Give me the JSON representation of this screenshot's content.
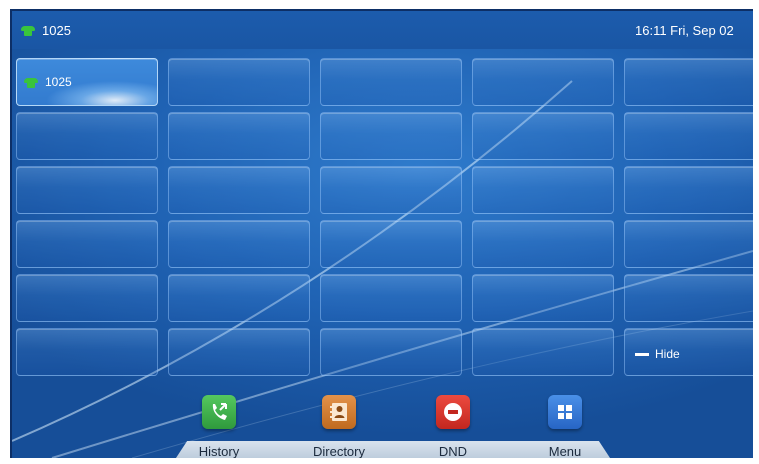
{
  "status_bar": {
    "account": "1025",
    "datetime": "16:11 Fri, Sep 02"
  },
  "line_keys": {
    "selected_label": "1025",
    "hide_label": "Hide"
  },
  "softkeys": [
    {
      "label": "History",
      "icon": "phone-history-icon",
      "color": "#3aa84a"
    },
    {
      "label": "Directory",
      "icon": "contact-card-icon",
      "color": "#d27a2a"
    },
    {
      "label": "DND",
      "icon": "no-entry-icon",
      "color": "#d8322a"
    },
    {
      "label": "Menu",
      "icon": "grid-menu-icon",
      "color": "#2f78d8"
    }
  ]
}
